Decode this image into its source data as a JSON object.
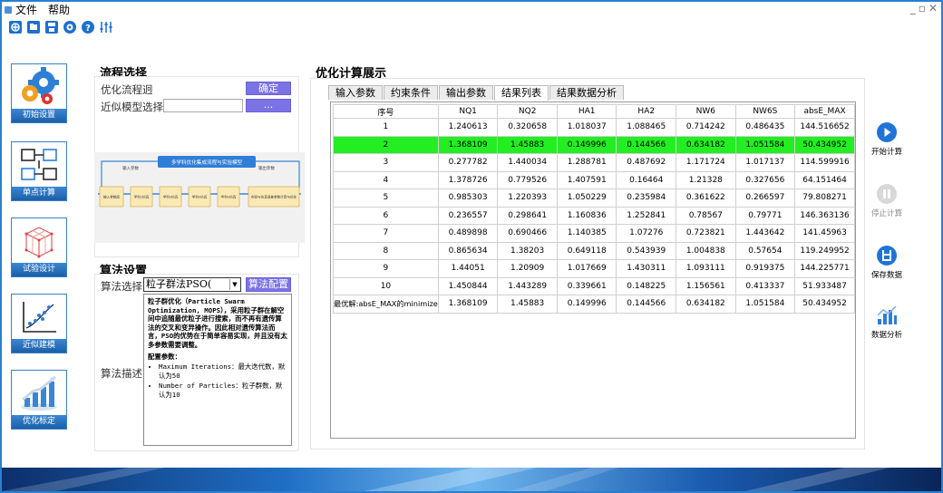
{
  "menu": {
    "file": "文件",
    "help": "帮助"
  },
  "nav": [
    {
      "label": "初始设置",
      "icon": "gears-icon"
    },
    {
      "label": "单点计算",
      "icon": "blocks-icon"
    },
    {
      "label": "试验设计",
      "icon": "cube-grid-icon"
    },
    {
      "label": "近似建模",
      "icon": "scatter-icon"
    },
    {
      "label": "优化标定",
      "icon": "bar-chart-icon"
    }
  ],
  "flow": {
    "title": "流程选择",
    "opt_label": "优化流程迥",
    "opt_button": "确定",
    "model_label": "近似模型选择",
    "model_button": "...",
    "diagram": {
      "header": "多学科优化集成流程与实验模型",
      "left_note": "输入参数",
      "right_note": "输出参数",
      "steps": [
        "输入参数面",
        "学科1仿真",
        "学科2仿真",
        "学科n仿真",
        "学科n仿真",
        "实验与仿真误差参数计算与优化"
      ]
    }
  },
  "algo": {
    "title": "算法设置",
    "select_label": "算法选择",
    "select_value": "粒子群法PSO(",
    "config_button": "算法配置",
    "desc_label": "算法描述",
    "desc_title": "粒子群优化（Particle Swarm Optimization, MOPS），采用粒子群在解空间中追随最优粒子进行搜索，而不再有遗传算法的交叉和变异操作。因此相对遗传算法而言，PSO的优势在于简单容易实现，并且没有太多参数需要调整。",
    "params_title": "配置参数：",
    "params": [
      "Maximum Iterations：最大迭代数，默认为50",
      "Number of Particles：粒子群数，默认为10"
    ]
  },
  "results": {
    "title": "优化计算展示",
    "tabs": [
      "输入参数",
      "约束条件",
      "输出参数",
      "结果列表",
      "结果数据分析"
    ],
    "columns": [
      "序号",
      "NQ1",
      "NQ2",
      "HA1",
      "HA2",
      "NW6",
      "NW6S",
      "absE_MAX"
    ],
    "rows": [
      [
        "1",
        "1.240613",
        "0.320658",
        "1.018037",
        "1.088465",
        "0.714242",
        "0.486435",
        "144.516652"
      ],
      [
        "2",
        "1.368109",
        "1.45883",
        "0.149996",
        "0.144566",
        "0.634182",
        "1.051584",
        "50.434952"
      ],
      [
        "3",
        "0.277782",
        "1.440034",
        "1.288781",
        "0.487692",
        "1.171724",
        "1.017137",
        "114.599916"
      ],
      [
        "4",
        "1.378726",
        "0.779526",
        "1.407591",
        "0.16464",
        "1.21328",
        "0.327656",
        "64.151464"
      ],
      [
        "5",
        "0.985303",
        "1.220393",
        "1.050229",
        "0.235984",
        "0.361622",
        "0.266597",
        "79.808271"
      ],
      [
        "6",
        "0.236557",
        "0.298641",
        "1.160836",
        "1.252841",
        "0.78567",
        "0.79771",
        "146.363136"
      ],
      [
        "7",
        "0.489898",
        "0.690466",
        "1.140385",
        "1.07276",
        "0.723821",
        "1.443642",
        "141.45963"
      ],
      [
        "8",
        "0.865634",
        "1.38203",
        "0.649118",
        "0.543939",
        "1.004838",
        "0.57654",
        "119.249952"
      ],
      [
        "9",
        "1.44051",
        "1.20909",
        "1.017669",
        "1.430311",
        "1.093111",
        "0.919375",
        "144.225771"
      ],
      [
        "10",
        "1.450844",
        "1.443289",
        "0.339661",
        "0.148225",
        "1.156561",
        "0.413337",
        "51.933487"
      ],
      [
        "最优解:absE_MAX的minimize",
        "1.368109",
        "1.45883",
        "0.149996",
        "0.144566",
        "0.634182",
        "1.051584",
        "50.434952"
      ]
    ],
    "highlight_row": 1
  },
  "actions": [
    {
      "label": "开始计算",
      "icon": "play-icon"
    },
    {
      "label": "停止计算",
      "icon": "pause-icon"
    },
    {
      "label": "保存数据",
      "icon": "save-icon"
    },
    {
      "label": "数据分析",
      "icon": "analysis-icon"
    }
  ],
  "colors": {
    "accent": "#7b72e6",
    "highlight": "#22ee22",
    "nav_label": "#2a74c6"
  }
}
